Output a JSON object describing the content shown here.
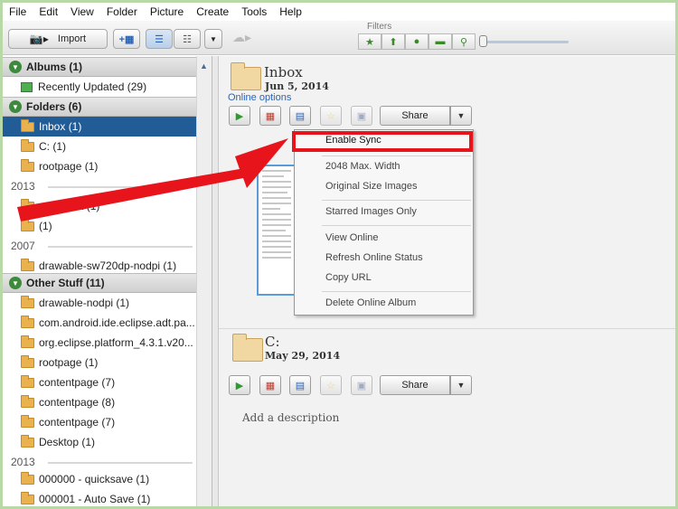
{
  "menubar": [
    "File",
    "Edit",
    "View",
    "Folder",
    "Picture",
    "Create",
    "Tools",
    "Help"
  ],
  "toolbar": {
    "import_label": "Import",
    "filters_label": "Filters"
  },
  "sidebar": {
    "albums_header": "Albums (1)",
    "recently_updated": "Recently Updated (29)",
    "folders_header": "Folders (6)",
    "folders": [
      "Inbox (1)",
      "C: (1)",
      "rootpage (1)"
    ],
    "year_2013a": "2013",
    "year2013_items": [
      "wikipedia (1)",
      "(1)"
    ],
    "year_2007": "2007",
    "year2007_items": [
      "drawable-sw720dp-nodpi (1)"
    ],
    "other_header": "Other Stuff (11)",
    "other_items": [
      "drawable-nodpi (1)",
      "com.android.ide.eclipse.adt.pa...",
      "org.eclipse.platform_4.3.1.v20...",
      "rootpage (1)",
      "contentpage (7)",
      "contentpage (8)",
      "contentpage (7)",
      "Desktop (1)"
    ],
    "year_2013b": "2013",
    "year2013b_items": [
      "000000 - quicksave (1)",
      "000001 - Auto Save (1)"
    ]
  },
  "main": {
    "album1": {
      "title": "Inbox",
      "date": "Jun 5, 2014",
      "online_options": "Online options",
      "share_label": "Share"
    },
    "album2": {
      "title": "C:",
      "date": "May 29, 2014",
      "share_label": "Share"
    },
    "description_placeholder": "Add a description"
  },
  "context_menu": {
    "items": [
      "Enable Sync",
      "2048 Max. Width",
      "Original Size Images",
      "Starred Images Only",
      "View Online",
      "Refresh Online Status",
      "Copy URL",
      "Delete Online Album"
    ]
  },
  "colors": {
    "highlight": "#e8141c",
    "selection": "#225c96",
    "folder": "#e9b24f"
  }
}
